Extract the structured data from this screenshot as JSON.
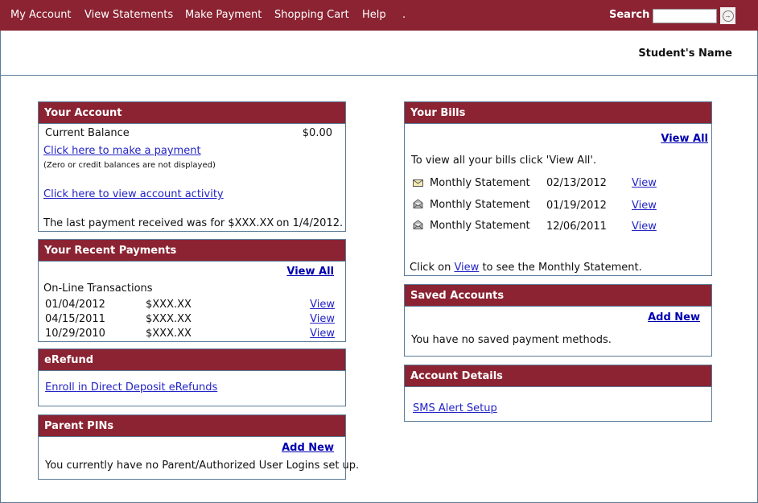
{
  "nav": {
    "items": [
      {
        "label": "My Account"
      },
      {
        "label": "View Statements"
      },
      {
        "label": "Make Payment"
      },
      {
        "label": "Shopping Cart"
      },
      {
        "label": "Help"
      },
      {
        "label": "."
      }
    ],
    "search_label": "Search",
    "search_value": "",
    "search_button_icon": "arrow-circle-icon"
  },
  "header": {
    "student_name": "Student's Name"
  },
  "colors": {
    "brand": "#8b2332",
    "border": "#5b7c99",
    "link": "#2424c6"
  },
  "your_account": {
    "title": "Your Account",
    "balance_label": "Current Balance",
    "balance_value": "$0.00",
    "make_payment_link": "Click here to make a payment",
    "note": "(Zero or credit balances are not displayed)",
    "view_activity_link": "Click here to view account activity",
    "last_payment_prefix": "The last payment received was for",
    "last_payment_amount": "$XXX.XX",
    "last_payment_suffix": "on 1/4/2012."
  },
  "recent_payments": {
    "title": "Your Recent Payments",
    "view_all": "View All",
    "section_label": "On-Line Transactions",
    "rows": [
      {
        "date": "01/04/2012",
        "amount": "$XXX.XX",
        "action": "View"
      },
      {
        "date": "04/15/2011",
        "amount": "$XXX.XX",
        "action": "View"
      },
      {
        "date": "10/29/2010",
        "amount": "$XXX.XX",
        "action": "View"
      }
    ]
  },
  "erefund": {
    "title": "eRefund",
    "enroll_link": "Enroll in Direct Deposit eRefunds"
  },
  "parent_pins": {
    "title": "Parent PINs",
    "add_new": "Add New",
    "message": "You currently have no Parent/Authorized User Logins set up."
  },
  "your_bills": {
    "title": "Your Bills",
    "view_all": "View All",
    "intro": "To view all your bills click 'View All'.",
    "rows": [
      {
        "icon": "envelope-closed-icon",
        "name": "Monthly Statement",
        "date": "02/13/2012",
        "action": "View"
      },
      {
        "icon": "envelope-open-icon",
        "name": "Monthly Statement",
        "date": "01/19/2012",
        "action": "View"
      },
      {
        "icon": "envelope-open-icon",
        "name": "Monthly Statement",
        "date": "12/06/2011",
        "action": "View"
      }
    ],
    "footer_prefix": "Click on",
    "footer_link": "View",
    "footer_suffix": "to see the Monthly Statement."
  },
  "saved_accounts": {
    "title": "Saved Accounts",
    "add_new": "Add New",
    "message": "You have no saved payment methods."
  },
  "account_details": {
    "title": "Account Details",
    "sms_link": "SMS Alert Setup"
  }
}
